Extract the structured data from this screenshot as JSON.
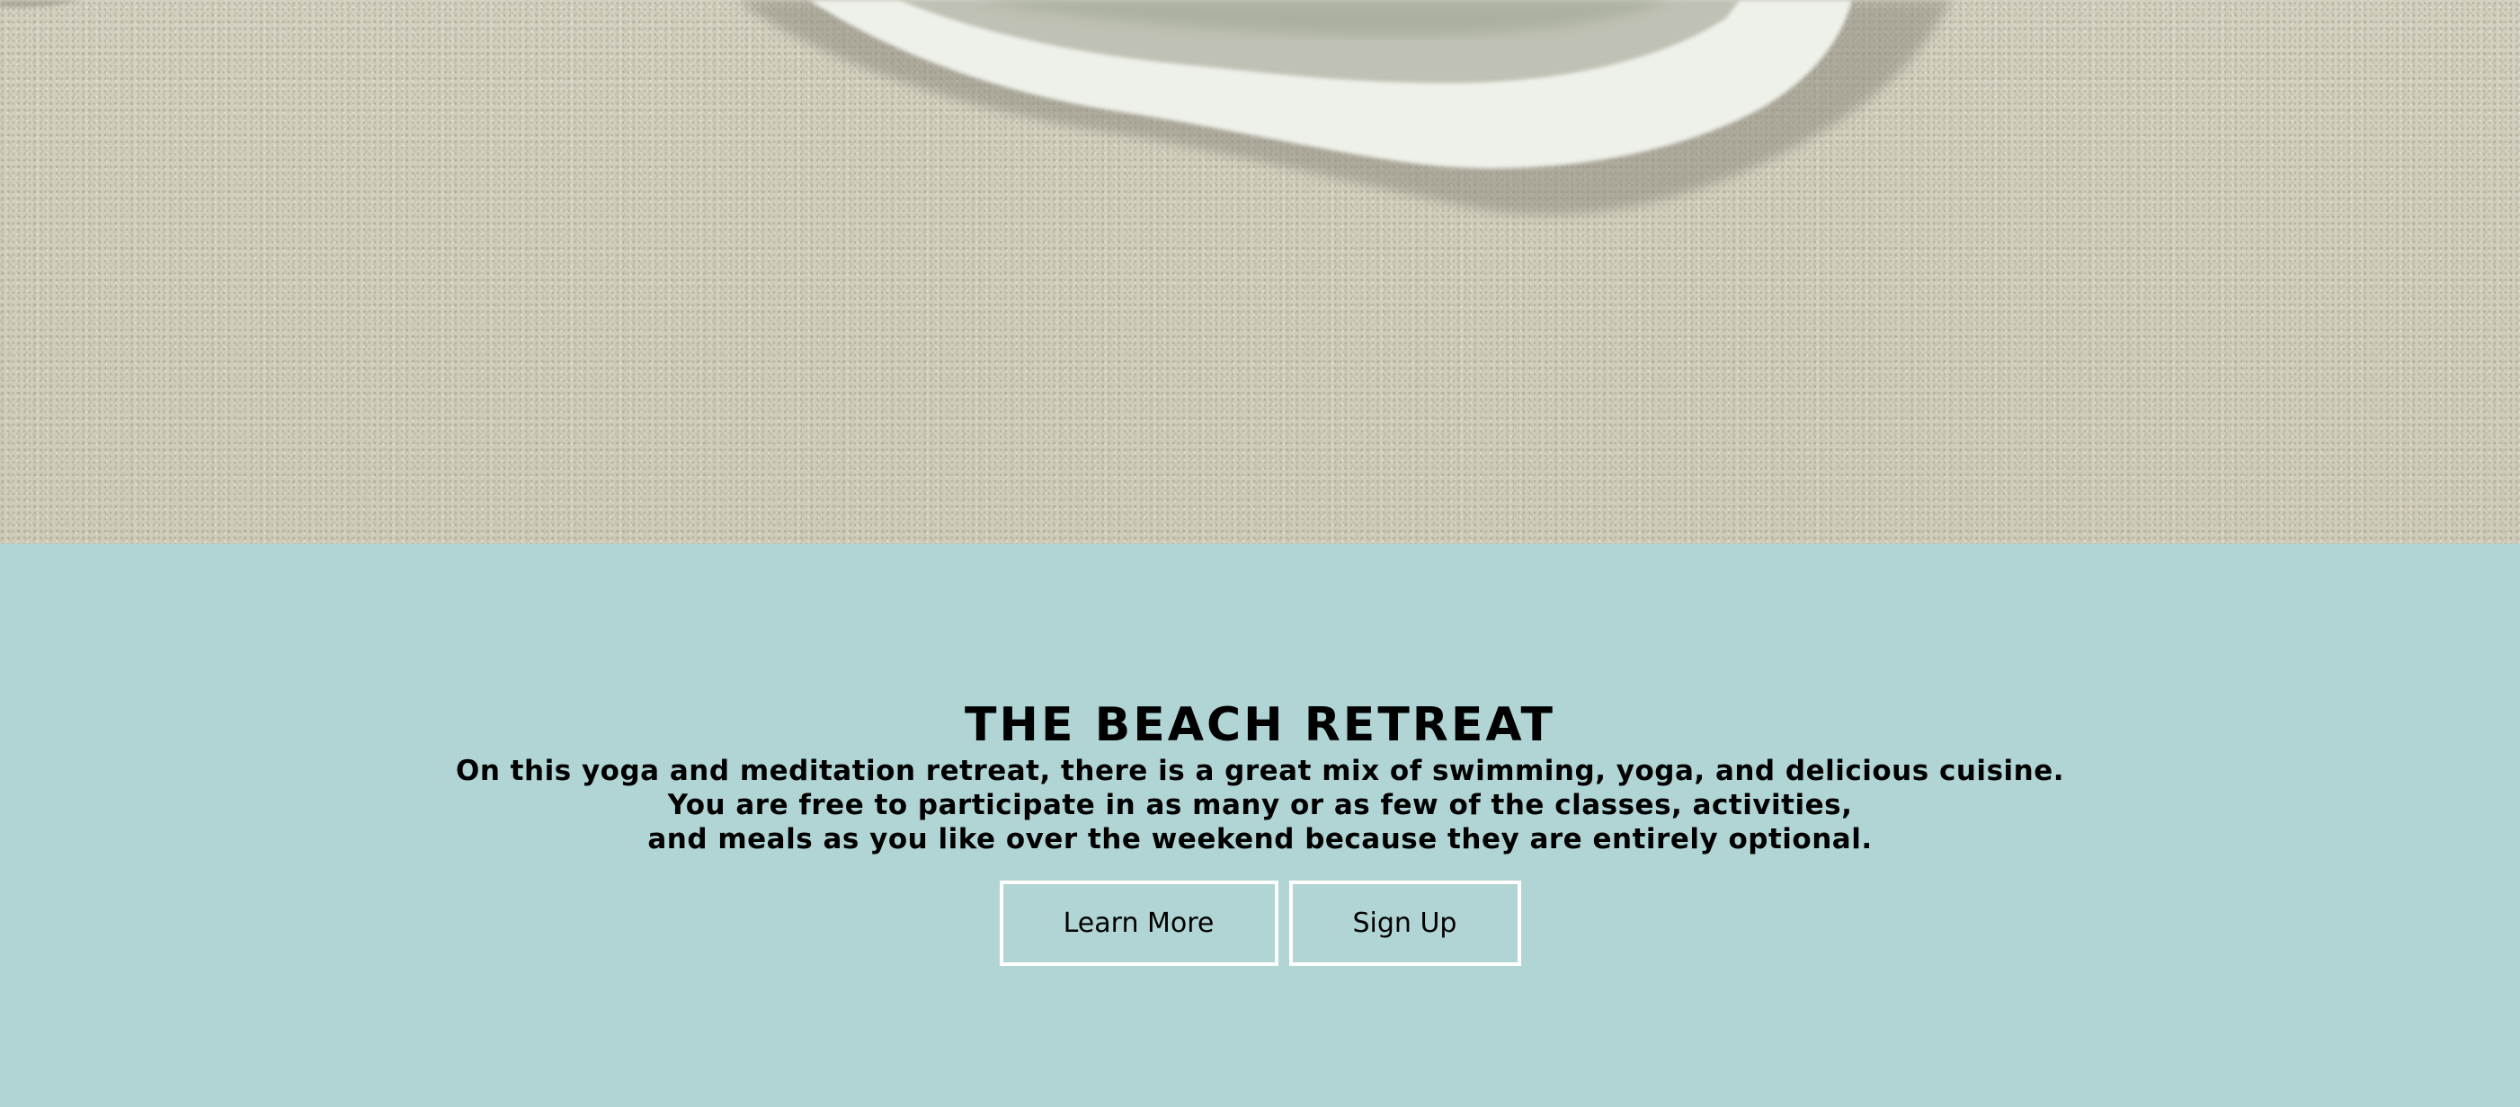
{
  "hero": {
    "image_name": "beach-sand-wave-image",
    "colors": {
      "sand": "#d2cebd",
      "foam": "#f2f3ee"
    }
  },
  "retreat": {
    "title": "THE BEACH RETREAT",
    "description_lines": [
      "On this yoga and meditation retreat, there is a great mix of swimming, yoga, and delicious cuisine.",
      "You are free to participate in as many or as few of the classes, activities,",
      "and meals as you like over the weekend because they are entirely optional."
    ],
    "buttons": {
      "learn_more": "Learn More",
      "sign_up": "Sign Up"
    },
    "colors": {
      "panel": "#b0d5d4",
      "button_border": "#ffffff",
      "text": "#000000"
    }
  }
}
